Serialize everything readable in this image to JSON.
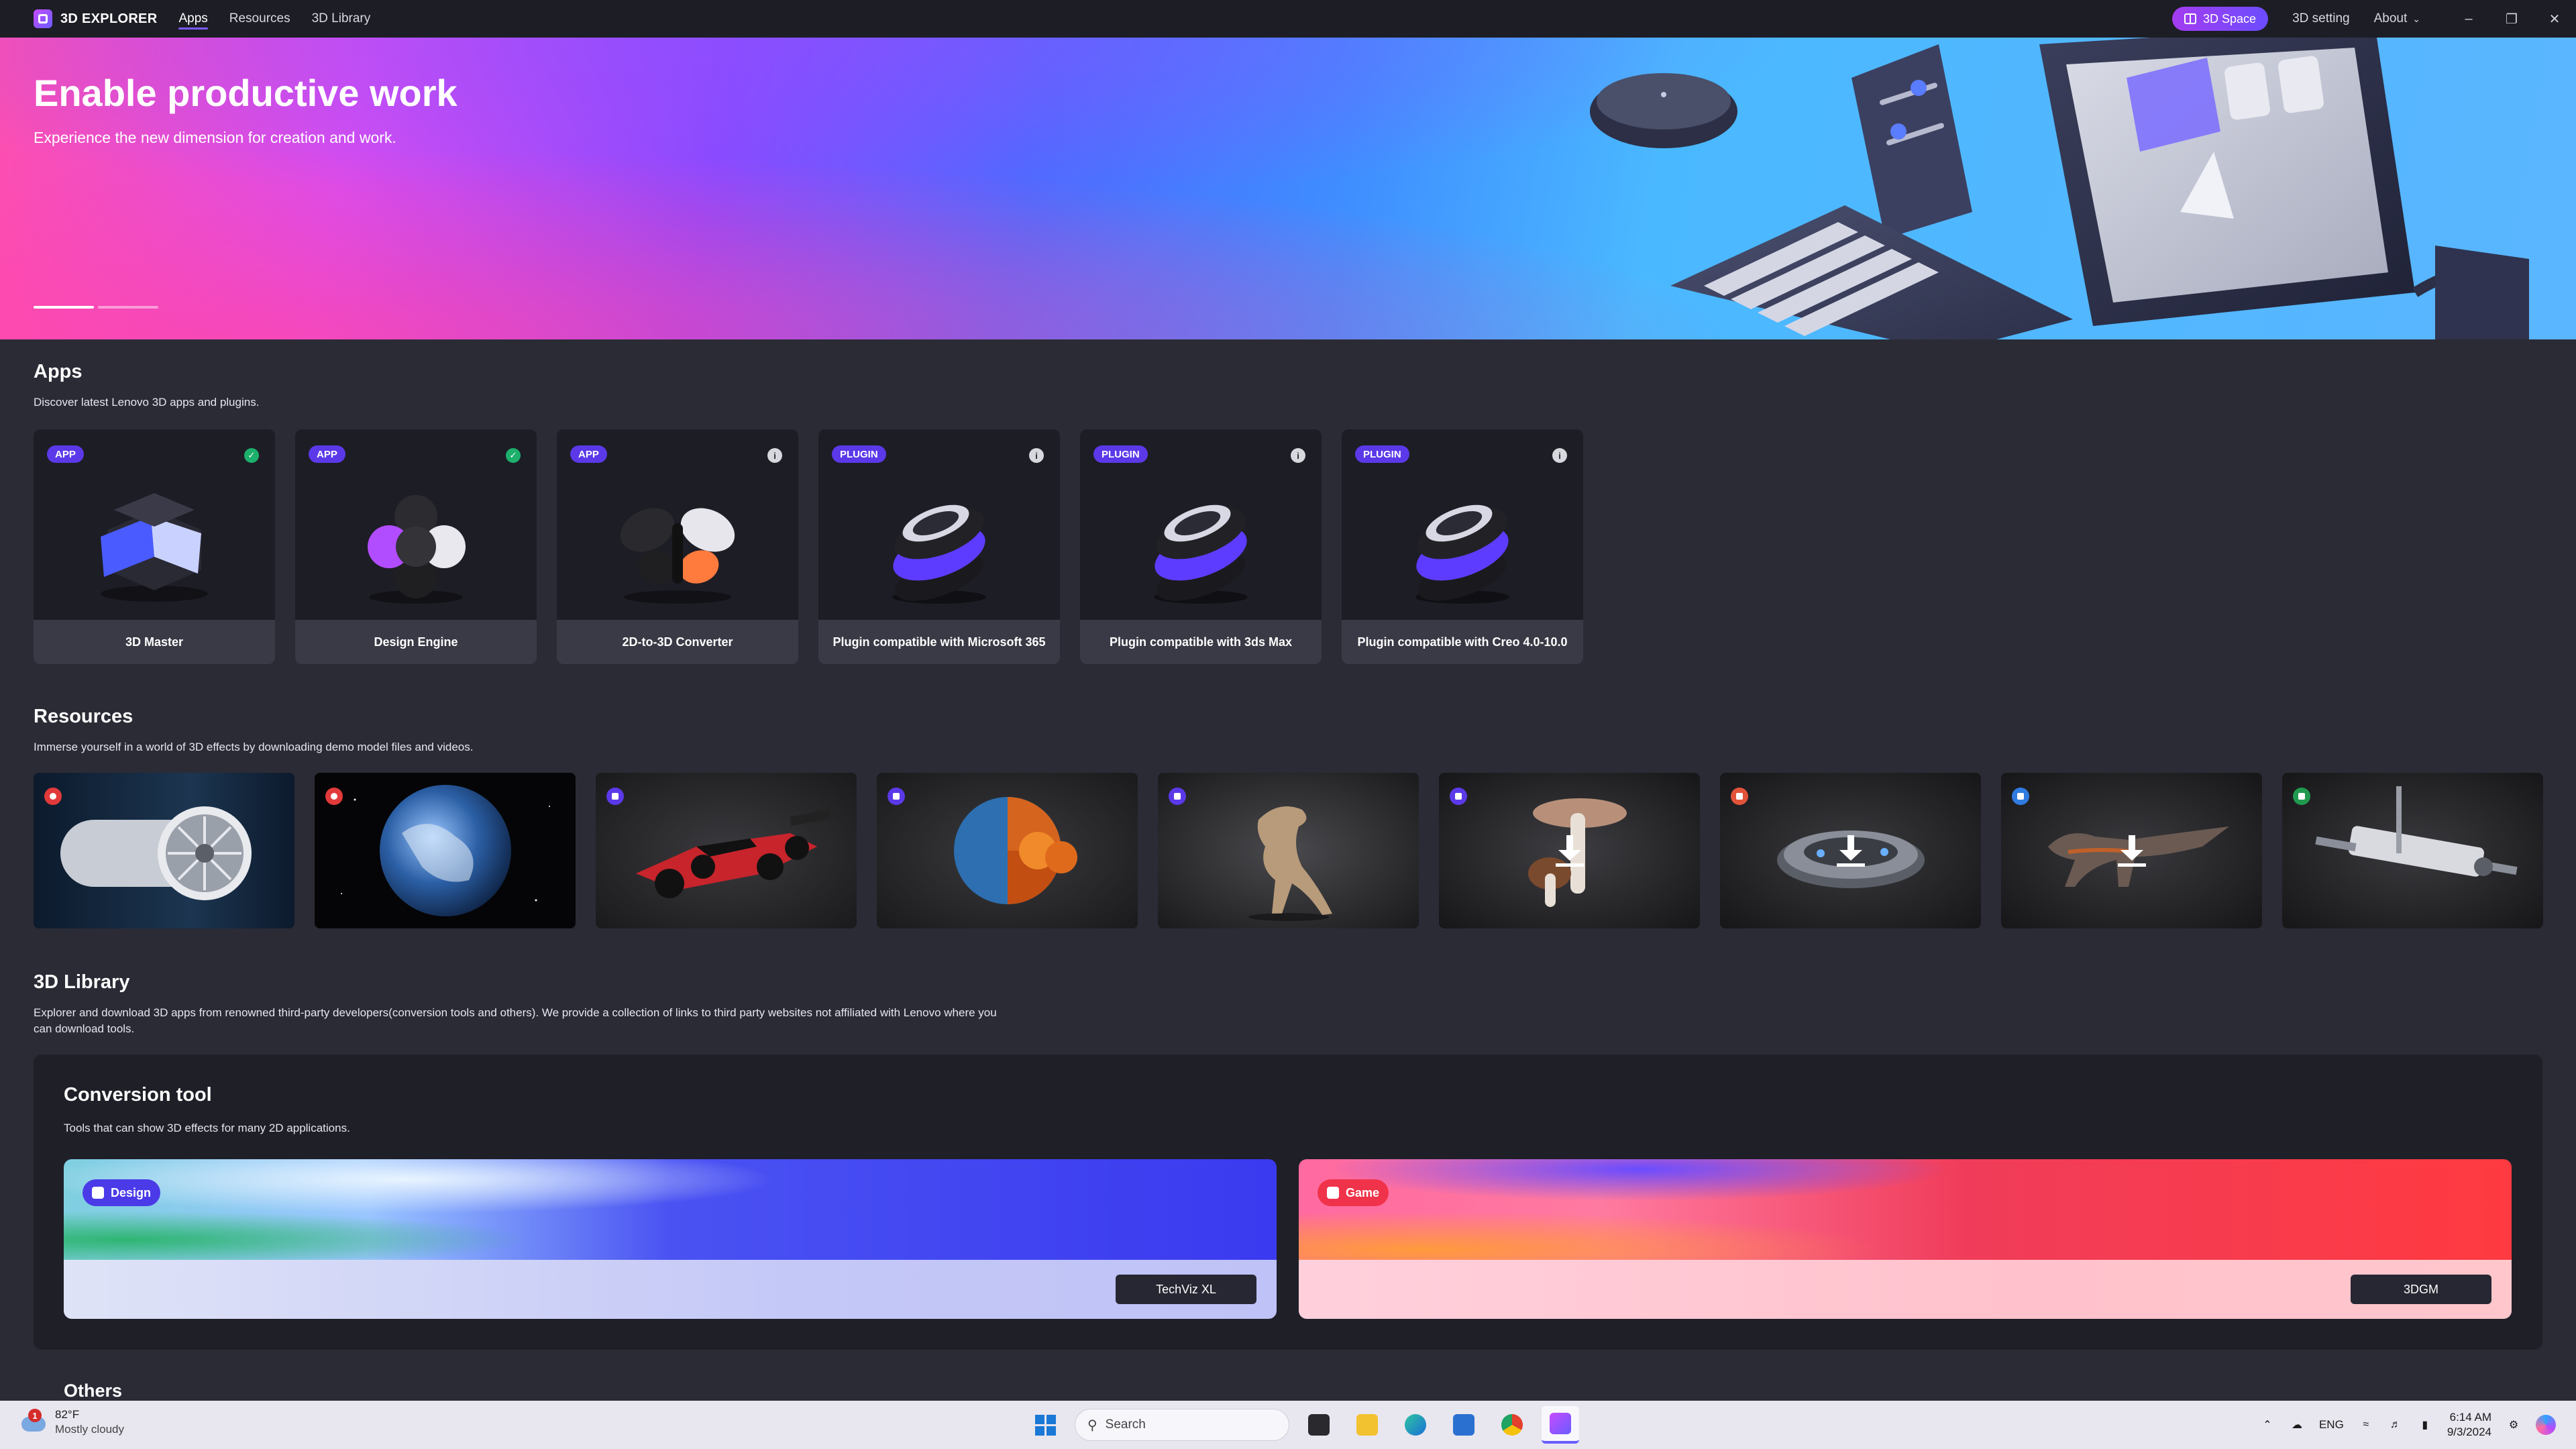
{
  "app": {
    "brand": "3D EXPLORER",
    "nav": [
      "Apps",
      "Resources",
      "3D Library"
    ],
    "space_button": "3D Space",
    "setting_link": "3D setting",
    "about_link": "About",
    "window_controls": {
      "minimize": "–",
      "restore": "❐",
      "close": "✕"
    }
  },
  "hero": {
    "title": "Enable productive work",
    "subtitle": "Experience the new dimension for creation and work."
  },
  "apps_section": {
    "title": "Apps",
    "description": "Discover latest Lenovo 3D apps and plugins.",
    "items": [
      {
        "badge": "APP",
        "name": "3D Master",
        "status": "installed"
      },
      {
        "badge": "APP",
        "name": "Design Engine",
        "status": "installed"
      },
      {
        "badge": "APP",
        "name": "2D-to-3D Converter",
        "status": "info"
      },
      {
        "badge": "PLUGIN",
        "name": "Plugin compatible with Microsoft 365",
        "status": "info"
      },
      {
        "badge": "PLUGIN",
        "name": "Plugin compatible with 3ds Max",
        "status": "info"
      },
      {
        "badge": "PLUGIN",
        "name": "Plugin compatible with Creo 4.0-10.0",
        "status": "info"
      }
    ],
    "status_glyphs": {
      "installed": "✓",
      "info": "i"
    }
  },
  "resources_section": {
    "title": "Resources",
    "description": "Immerse yourself in a world of 3D effects by downloading demo model files and videos."
  },
  "library_section": {
    "title": "3D Library",
    "description_line1": "Explorer and download 3D apps from renowned third-party developers(conversion tools and others). We provide a collection of links to third party websites not affiliated with Lenovo where you",
    "description_line2": "can download tools.",
    "conversion": {
      "title": "Conversion tool",
      "description": "Tools that can show 3D effects for many 2D applications.",
      "tools": [
        {
          "tag": "Design",
          "button": "TechViz XL"
        },
        {
          "tag": "Game",
          "button": "3DGM"
        }
      ]
    },
    "others_title": "Others"
  },
  "taskbar": {
    "weather_temp": "82°F",
    "weather_desc": "Mostly cloudy",
    "weather_badge": "1",
    "search_placeholder": "Search",
    "language": "ENG",
    "time": "6:14 AM",
    "date": "9/3/2024"
  },
  "colors": {
    "background": "#2b2b36",
    "card": "#1d1d26",
    "accent": "#5b39e8",
    "installed_green": "#1db06c"
  }
}
